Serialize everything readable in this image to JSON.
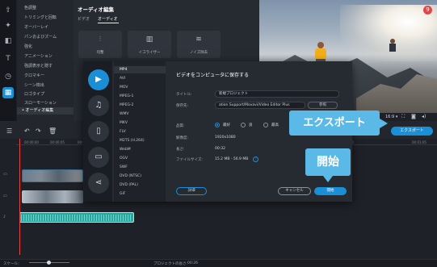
{
  "left_rail": {
    "icons": [
      "import-icon",
      "magic-icon",
      "filters-icon",
      "text-icon",
      "history-icon",
      "more-tools-icon"
    ]
  },
  "effects": {
    "items": [
      "色調整",
      "トリミングと回転",
      "オーバーレイ",
      "パンおよびズーム",
      "強化",
      "アニメーション",
      "強調表示と隠す",
      "クロマキー",
      "シーン検出",
      "ロゴタイプ",
      "スローモーション",
      "オーディオ編集"
    ],
    "selected": "オーディオ編集",
    "bullet": "•"
  },
  "audio_panel": {
    "title": "オーディオ編集",
    "tabs": [
      "ビデオ",
      "オーディオ"
    ],
    "active_tab": "オーディオ",
    "buttons": [
      {
        "label": "均整",
        "icon": "equalizer-icon",
        "glyph": "⫶"
      },
      {
        "label": "イコライザー",
        "icon": "equalizer-bars-icon",
        "glyph": "▥"
      },
      {
        "label": "ノイズ除去",
        "icon": "noise-removal-icon",
        "glyph": "≋"
      }
    ]
  },
  "preview": {
    "notification": "9",
    "aspect_ratio": "16:9 ▾",
    "icons": [
      "fullscreen-icon",
      "snapshot-icon",
      "volume-icon"
    ]
  },
  "timeline": {
    "toolbar_icons": [
      "undo-icon",
      "redo-icon",
      "delete-icon"
    ],
    "ticks": [
      "00:00:00",
      "00:00:05",
      "00:00:10",
      "00:00:15",
      "00:00:20",
      "00:00:25",
      "00:00:30",
      "00:00:35",
      "00:00:40",
      "00:00:45",
      "00:00:50",
      "00:01:00",
      "00:01:05"
    ],
    "export_button": "エクスポート"
  },
  "status_bar": {
    "scale_label": "スケール：",
    "project_length_label": "プロジェクトの長さ:",
    "project_length": "00:26"
  },
  "export_dialog": {
    "title": "ビデオをコンピュータに保存する",
    "formats": [
      "MP4",
      "AVI",
      "MOV",
      "MPEG-1",
      "MPEG-2",
      "WMV",
      "MKV",
      "FLV",
      "M2TS (H.264)",
      "WebM",
      "OGV",
      "SWF",
      "DVD (NTSC)",
      "DVD (PAL)",
      "GIF"
    ],
    "selected_format": "MP4",
    "format_icons": [
      "video-format-icon",
      "audio-format-icon",
      "device-icon",
      "tv-icon",
      "share-icon"
    ],
    "title_label": "タイトル:",
    "title_value": "新規プロジェクト",
    "save_to_label": "保存先:",
    "save_to_value": "ation Support/Movavi/Video Editor Plus",
    "browse_label": "参照",
    "quality_label": "品質:",
    "quality_options": [
      "最好",
      "良",
      "最高"
    ],
    "quality_selected": "最好",
    "resolution_label": "解像度:",
    "resolution_value": "1920x1080",
    "length_label": "長さ:",
    "length_value": "00:32",
    "filesize_label": "ファイルサイズ:",
    "filesize_value": "15.2 MB - 56.9 MB",
    "help": "?",
    "details_button": "詳細",
    "cancel_button": "キャンセル",
    "start_button": "開始"
  },
  "callouts": {
    "export": "エクスポート",
    "start": "開始"
  }
}
